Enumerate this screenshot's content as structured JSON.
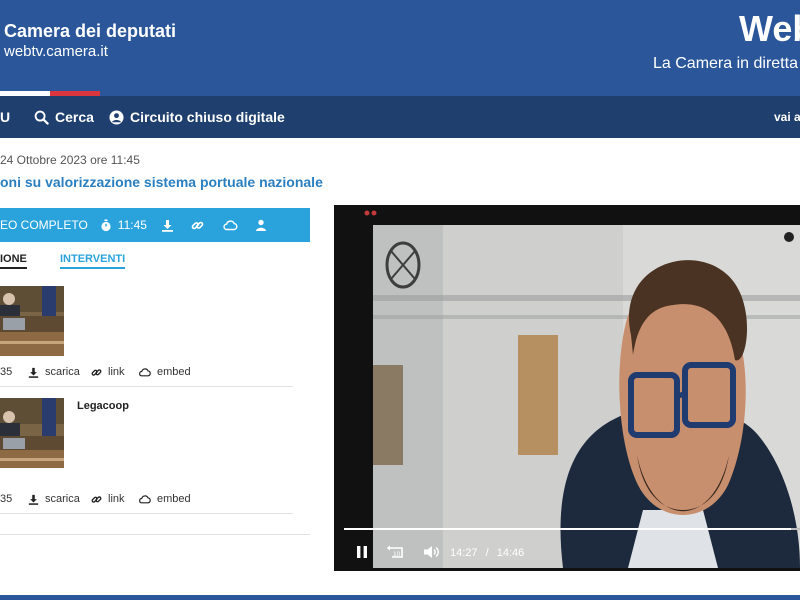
{
  "header": {
    "site_name": "Camera dei deputati",
    "site_url": "webtv.camera.it",
    "service_title": "Web",
    "service_subtitle": "La Camera in diretta"
  },
  "nav": {
    "item_u": "U",
    "search_label": "Cerca",
    "circuit_label": "Circuito chiuso digitale",
    "goto_label": "vai a"
  },
  "event": {
    "date_time": "24 Ottobre 2023 ore 11:45",
    "title": "oni su valorizzazione sistema portuale nazionale"
  },
  "video_bar": {
    "label": "EO COMPLETO",
    "time": "11:45"
  },
  "tabs": {
    "first": "IONE",
    "second": "INTERVENTI"
  },
  "entries": [
    {
      "label": "",
      "duration": "35",
      "download": "scarica",
      "link": "link",
      "embed": "embed"
    },
    {
      "label": "Legacoop",
      "duration": "35",
      "download": "scarica",
      "link": "link",
      "embed": "embed"
    }
  ],
  "player": {
    "current_time": "14:27",
    "separator": "/",
    "total_time": "14:46",
    "progress": 0.98
  },
  "colors": {
    "header_blue": "#2b579a",
    "nav_blue": "#1f3f6e",
    "accent_cyan": "#2aa3dc",
    "title_blue": "#2a7fc1",
    "flag_red": "#d9363e"
  }
}
